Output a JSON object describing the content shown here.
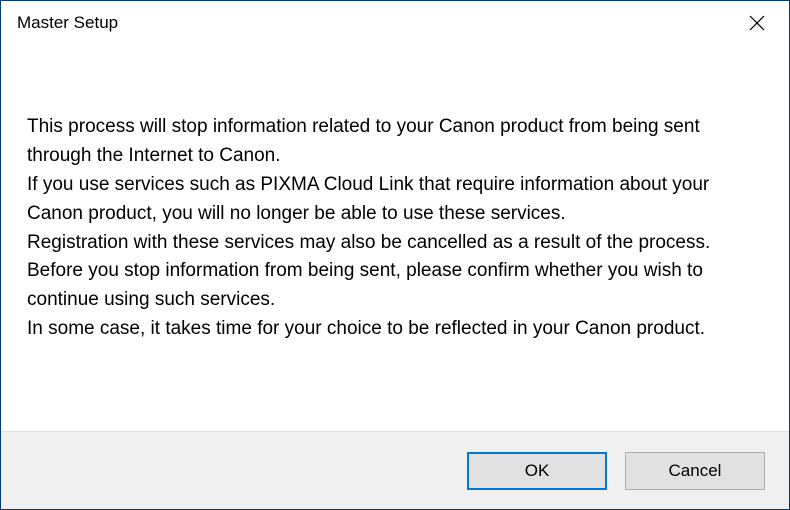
{
  "window": {
    "title": "Master Setup"
  },
  "content": {
    "message": "This process will stop information related to your Canon product from being sent through the Internet to Canon.\nIf you use services such as PIXMA Cloud Link that require information about your Canon product, you will no longer be able to use these services.\nRegistration with these services may also be cancelled as a result of the process. Before you stop information from being sent, please confirm whether you wish to continue using such services.\nIn some case, it takes time for your choice to be reflected in your Canon product."
  },
  "buttons": {
    "ok_label": "OK",
    "cancel_label": "Cancel"
  }
}
